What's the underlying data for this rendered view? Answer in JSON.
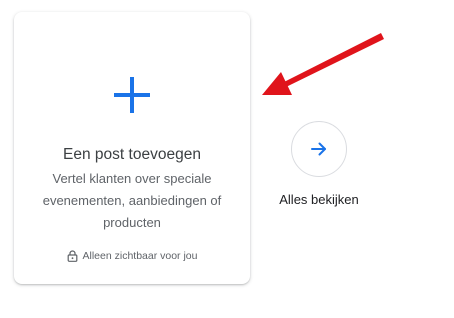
{
  "add_post_card": {
    "title": "Een post toevoegen",
    "description": "Vertel klanten over speciale evenementen, aanbiedingen of producten",
    "privacy_note": "Alleen zichtbaar voor jou",
    "icon": "plus-icon",
    "privacy_icon": "lock-icon"
  },
  "view_all": {
    "label": "Alles bekijken",
    "icon": "arrow-right-icon"
  },
  "annotation": {
    "type": "red-arrow",
    "points_to": "add-post-card"
  },
  "colors": {
    "accent_blue": "#1a73e8",
    "annotation_red": "#e0141b",
    "title_text": "#3c4043",
    "secondary_text": "#5f6368",
    "border": "#dadce0"
  }
}
